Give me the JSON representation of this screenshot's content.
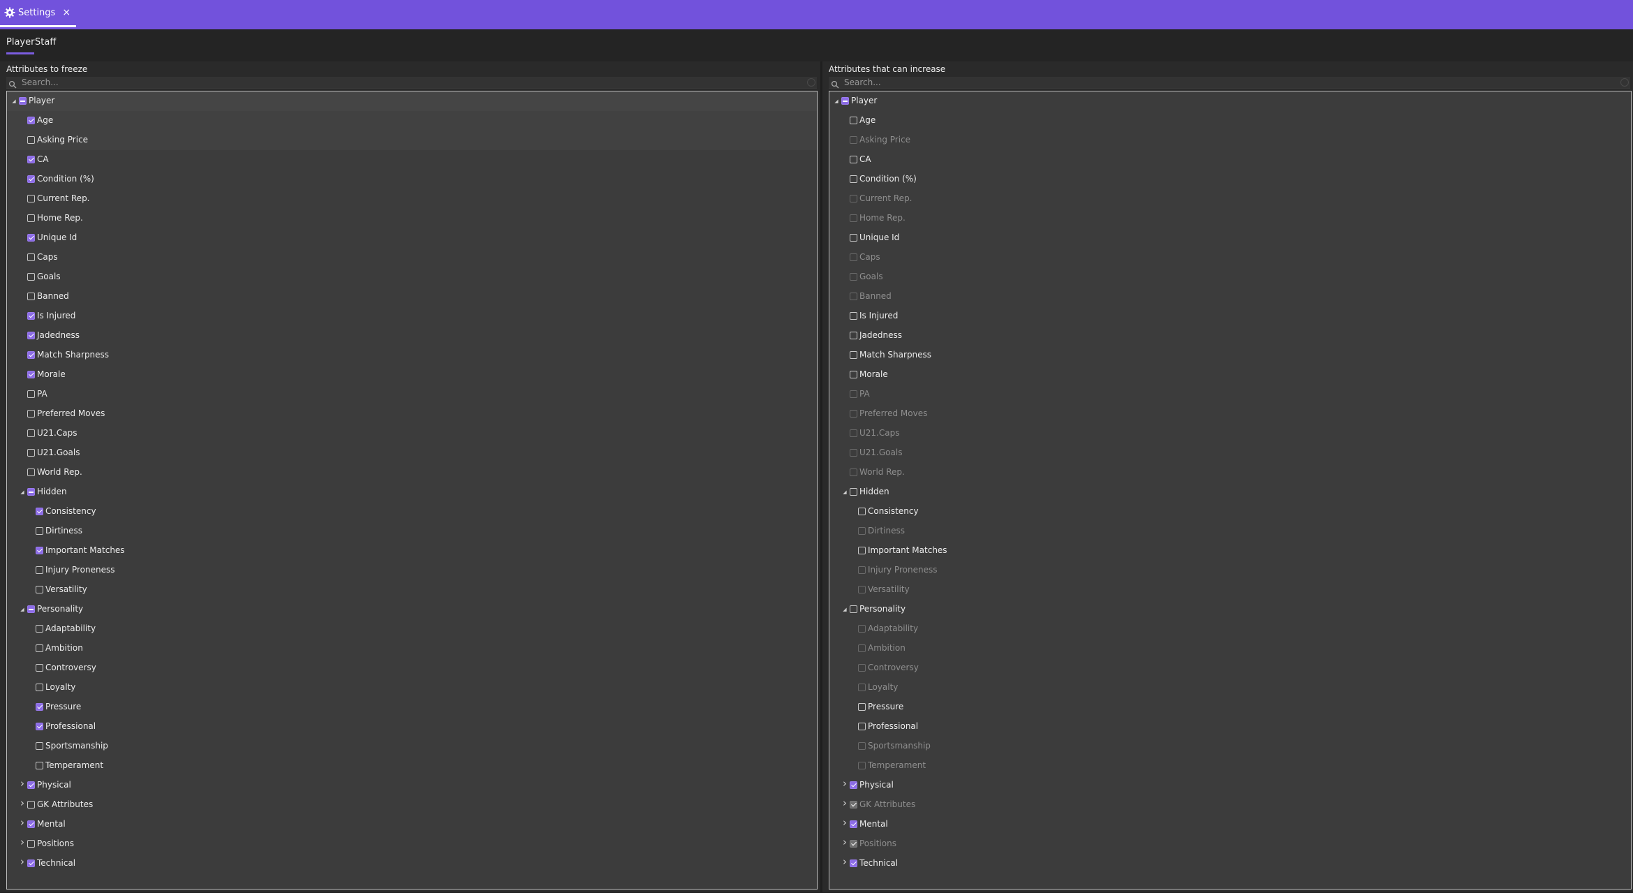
{
  "window": {
    "tab_title": "Settings",
    "close_glyph": "×",
    "icon": "gear-icon"
  },
  "tabs": [
    {
      "label": "Player",
      "active": true
    },
    {
      "label": "Staff",
      "active": false
    }
  ],
  "search_placeholder": "Search...",
  "colors": {
    "accent": "#7252dc",
    "check": "#8c6ce6"
  },
  "panels": [
    {
      "title": "Attributes to freeze",
      "rows": [
        {
          "label": "Player",
          "level": 0,
          "expander": "open",
          "state": "partial"
        },
        {
          "label": "Age",
          "level": 1,
          "state": "checked"
        },
        {
          "label": "Asking Price",
          "level": 1,
          "state": "unchecked"
        },
        {
          "label": "CA",
          "level": 1,
          "state": "checked"
        },
        {
          "label": "Condition (%)",
          "level": 1,
          "state": "checked"
        },
        {
          "label": "Current Rep.",
          "level": 1,
          "state": "unchecked"
        },
        {
          "label": "Home Rep.",
          "level": 1,
          "state": "unchecked"
        },
        {
          "label": "Unique Id",
          "level": 1,
          "state": "checked"
        },
        {
          "label": "Caps",
          "level": 1,
          "state": "unchecked"
        },
        {
          "label": "Goals",
          "level": 1,
          "state": "unchecked"
        },
        {
          "label": "Banned",
          "level": 1,
          "state": "unchecked"
        },
        {
          "label": "Is Injured",
          "level": 1,
          "state": "checked"
        },
        {
          "label": "Jadedness",
          "level": 1,
          "state": "checked"
        },
        {
          "label": "Match Sharpness",
          "level": 1,
          "state": "checked"
        },
        {
          "label": "Morale",
          "level": 1,
          "state": "checked"
        },
        {
          "label": "PA",
          "level": 1,
          "state": "unchecked"
        },
        {
          "label": "Preferred Moves",
          "level": 1,
          "state": "unchecked"
        },
        {
          "label": "U21.Caps",
          "level": 1,
          "state": "unchecked"
        },
        {
          "label": "U21.Goals",
          "level": 1,
          "state": "unchecked"
        },
        {
          "label": "World Rep.",
          "level": 1,
          "state": "unchecked"
        },
        {
          "label": "Hidden",
          "level": 1,
          "expander": "open",
          "state": "partial"
        },
        {
          "label": "Consistency",
          "level": 2,
          "state": "checked"
        },
        {
          "label": "Dirtiness",
          "level": 2,
          "state": "unchecked"
        },
        {
          "label": "Important Matches",
          "level": 2,
          "state": "checked"
        },
        {
          "label": "Injury Proneness",
          "level": 2,
          "state": "unchecked"
        },
        {
          "label": "Versatility",
          "level": 2,
          "state": "unchecked"
        },
        {
          "label": "Personality",
          "level": 1,
          "expander": "open",
          "state": "partial"
        },
        {
          "label": "Adaptability",
          "level": 2,
          "state": "unchecked"
        },
        {
          "label": "Ambition",
          "level": 2,
          "state": "unchecked"
        },
        {
          "label": "Controversy",
          "level": 2,
          "state": "unchecked"
        },
        {
          "label": "Loyalty",
          "level": 2,
          "state": "unchecked"
        },
        {
          "label": "Pressure",
          "level": 2,
          "state": "checked"
        },
        {
          "label": "Professional",
          "level": 2,
          "state": "checked"
        },
        {
          "label": "Sportsmanship",
          "level": 2,
          "state": "unchecked"
        },
        {
          "label": "Temperament",
          "level": 2,
          "state": "unchecked"
        },
        {
          "label": "Physical",
          "level": 1,
          "expander": "closed",
          "state": "checked"
        },
        {
          "label": "GK Attributes",
          "level": 1,
          "expander": "closed",
          "state": "unchecked"
        },
        {
          "label": "Mental",
          "level": 1,
          "expander": "closed",
          "state": "checked"
        },
        {
          "label": "Positions",
          "level": 1,
          "expander": "closed",
          "state": "unchecked"
        },
        {
          "label": "Technical",
          "level": 1,
          "expander": "closed",
          "state": "checked"
        }
      ]
    },
    {
      "title": "Attributes that can increase",
      "rows": [
        {
          "label": "Player",
          "level": 0,
          "expander": "open",
          "state": "partial"
        },
        {
          "label": "Age",
          "level": 1,
          "state": "unchecked"
        },
        {
          "label": "Asking Price",
          "level": 1,
          "state": "unchecked",
          "disabled": true
        },
        {
          "label": "CA",
          "level": 1,
          "state": "unchecked"
        },
        {
          "label": "Condition (%)",
          "level": 1,
          "state": "unchecked"
        },
        {
          "label": "Current Rep.",
          "level": 1,
          "state": "unchecked",
          "disabled": true
        },
        {
          "label": "Home Rep.",
          "level": 1,
          "state": "unchecked",
          "disabled": true
        },
        {
          "label": "Unique Id",
          "level": 1,
          "state": "unchecked"
        },
        {
          "label": "Caps",
          "level": 1,
          "state": "unchecked",
          "disabled": true
        },
        {
          "label": "Goals",
          "level": 1,
          "state": "unchecked",
          "disabled": true
        },
        {
          "label": "Banned",
          "level": 1,
          "state": "unchecked",
          "disabled": true
        },
        {
          "label": "Is Injured",
          "level": 1,
          "state": "unchecked"
        },
        {
          "label": "Jadedness",
          "level": 1,
          "state": "unchecked"
        },
        {
          "label": "Match Sharpness",
          "level": 1,
          "state": "unchecked"
        },
        {
          "label": "Morale",
          "level": 1,
          "state": "unchecked"
        },
        {
          "label": "PA",
          "level": 1,
          "state": "unchecked",
          "disabled": true
        },
        {
          "label": "Preferred Moves",
          "level": 1,
          "state": "unchecked",
          "disabled": true
        },
        {
          "label": "U21.Caps",
          "level": 1,
          "state": "unchecked",
          "disabled": true
        },
        {
          "label": "U21.Goals",
          "level": 1,
          "state": "unchecked",
          "disabled": true
        },
        {
          "label": "World Rep.",
          "level": 1,
          "state": "unchecked",
          "disabled": true
        },
        {
          "label": "Hidden",
          "level": 1,
          "expander": "open",
          "state": "unchecked"
        },
        {
          "label": "Consistency",
          "level": 2,
          "state": "unchecked"
        },
        {
          "label": "Dirtiness",
          "level": 2,
          "state": "unchecked",
          "disabled": true
        },
        {
          "label": "Important Matches",
          "level": 2,
          "state": "unchecked"
        },
        {
          "label": "Injury Proneness",
          "level": 2,
          "state": "unchecked",
          "disabled": true
        },
        {
          "label": "Versatility",
          "level": 2,
          "state": "unchecked",
          "disabled": true
        },
        {
          "label": "Personality",
          "level": 1,
          "expander": "open",
          "state": "unchecked"
        },
        {
          "label": "Adaptability",
          "level": 2,
          "state": "unchecked",
          "disabled": true
        },
        {
          "label": "Ambition",
          "level": 2,
          "state": "unchecked",
          "disabled": true
        },
        {
          "label": "Controversy",
          "level": 2,
          "state": "unchecked",
          "disabled": true
        },
        {
          "label": "Loyalty",
          "level": 2,
          "state": "unchecked",
          "disabled": true
        },
        {
          "label": "Pressure",
          "level": 2,
          "state": "unchecked"
        },
        {
          "label": "Professional",
          "level": 2,
          "state": "unchecked"
        },
        {
          "label": "Sportsmanship",
          "level": 2,
          "state": "unchecked",
          "disabled": true
        },
        {
          "label": "Temperament",
          "level": 2,
          "state": "unchecked",
          "disabled": true
        },
        {
          "label": "Physical",
          "level": 1,
          "expander": "closed",
          "state": "checked"
        },
        {
          "label": "GK Attributes",
          "level": 1,
          "expander": "closed",
          "state": "checked",
          "disabled": true
        },
        {
          "label": "Mental",
          "level": 1,
          "expander": "closed",
          "state": "checked"
        },
        {
          "label": "Positions",
          "level": 1,
          "expander": "closed",
          "state": "checked",
          "disabled": true
        },
        {
          "label": "Technical",
          "level": 1,
          "expander": "closed",
          "state": "checked"
        }
      ]
    }
  ]
}
